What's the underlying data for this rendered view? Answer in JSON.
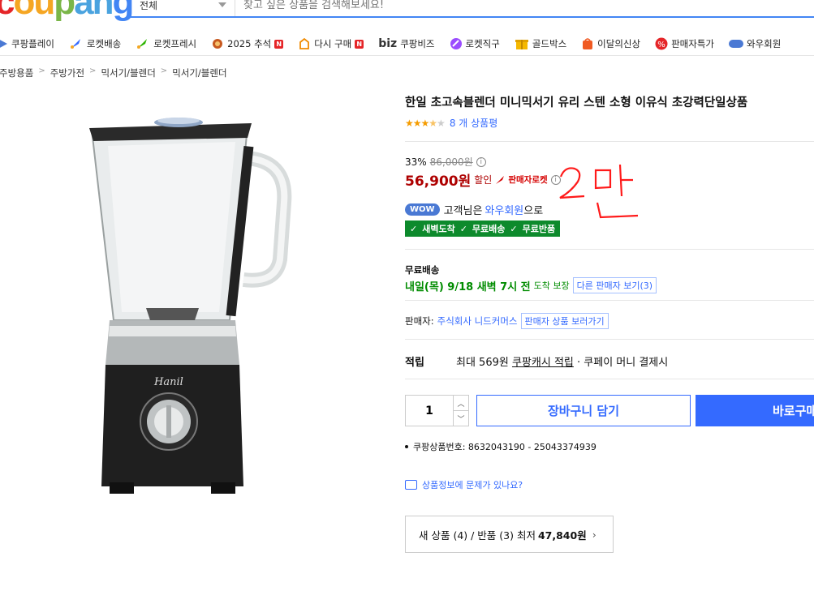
{
  "header": {
    "logo_text": "coupang",
    "search_category": "전체",
    "search_placeholder": "찾고 싶은 상품을 검색해보세요!"
  },
  "nav": {
    "items": [
      {
        "label": "쿠팡플레이",
        "icon": "play-icon"
      },
      {
        "label": "로켓배송",
        "icon": "rocket-icon"
      },
      {
        "label": "로켓프레시",
        "icon": "rocket-fresh-icon"
      },
      {
        "label": "2025 추석",
        "icon": "chuseok-icon",
        "badge": "N"
      },
      {
        "label": "다시 구매",
        "icon": "rebuy-icon",
        "badge": "N"
      },
      {
        "label": "쿠팡비즈",
        "icon": "biz-icon",
        "prefix": "biz"
      },
      {
        "label": "로켓직구",
        "icon": "global-icon"
      },
      {
        "label": "골드박스",
        "icon": "goldbox-icon"
      },
      {
        "label": "이달의신상",
        "icon": "new-icon"
      },
      {
        "label": "판매자특가",
        "icon": "percent-icon"
      },
      {
        "label": "와우회원",
        "icon": "wow-icon"
      }
    ]
  },
  "breadcrumb": [
    "주방용품",
    "주방가전",
    "믹서기/블렌더",
    "믹서기/블렌더"
  ],
  "product": {
    "title": "한일 초고속블렌더 미니믹서기 유리 스텐 소형 이유식 초강력단일상품",
    "rating": 3.5,
    "review_count": "8 개 상품평",
    "discount_rate": "33%",
    "original_price": "86,000원",
    "sale_price": "56,900원",
    "sale_label": "할인",
    "seller_rocket": "판매자로켓",
    "handwritten_note": "2만",
    "wow_pill": "WOW",
    "wow_text_before": "고객님은",
    "wow_link": "와우회원",
    "wow_text_after": "으로",
    "benefits": [
      "새벽도착",
      "무료배송",
      "무료반품"
    ],
    "shipping_title": "무료배송",
    "shipping_date": "내일(목) 9/18 새벽 7시 전",
    "shipping_note": "도착 보장",
    "other_sellers": "다른 판매자 보기(3)",
    "seller_label": "판매자:",
    "seller_name": "주식회사 니드커머스",
    "seller_products": "판매자 상품 보러가기",
    "points_label": "적립",
    "points_text_1": "최대 569원",
    "points_link": "쿠팡캐시 적립",
    "points_text_2": "· 쿠페이 머니 결제시",
    "quantity": "1",
    "cart_button": "장바구니 담기",
    "buy_button": "바로구매",
    "product_number": "쿠팡상품번호: 8632043190 - 25043374939",
    "report_text": "상품정보에 문제가 있나요?",
    "new_item_text": "새 상품 (4) / 반품 (3) 최저",
    "new_item_price": "47,840원"
  },
  "colors": {
    "accent": "#346aff",
    "sale_red": "#ae0000",
    "green": "#0d8a2c",
    "star": "#f59c00"
  }
}
